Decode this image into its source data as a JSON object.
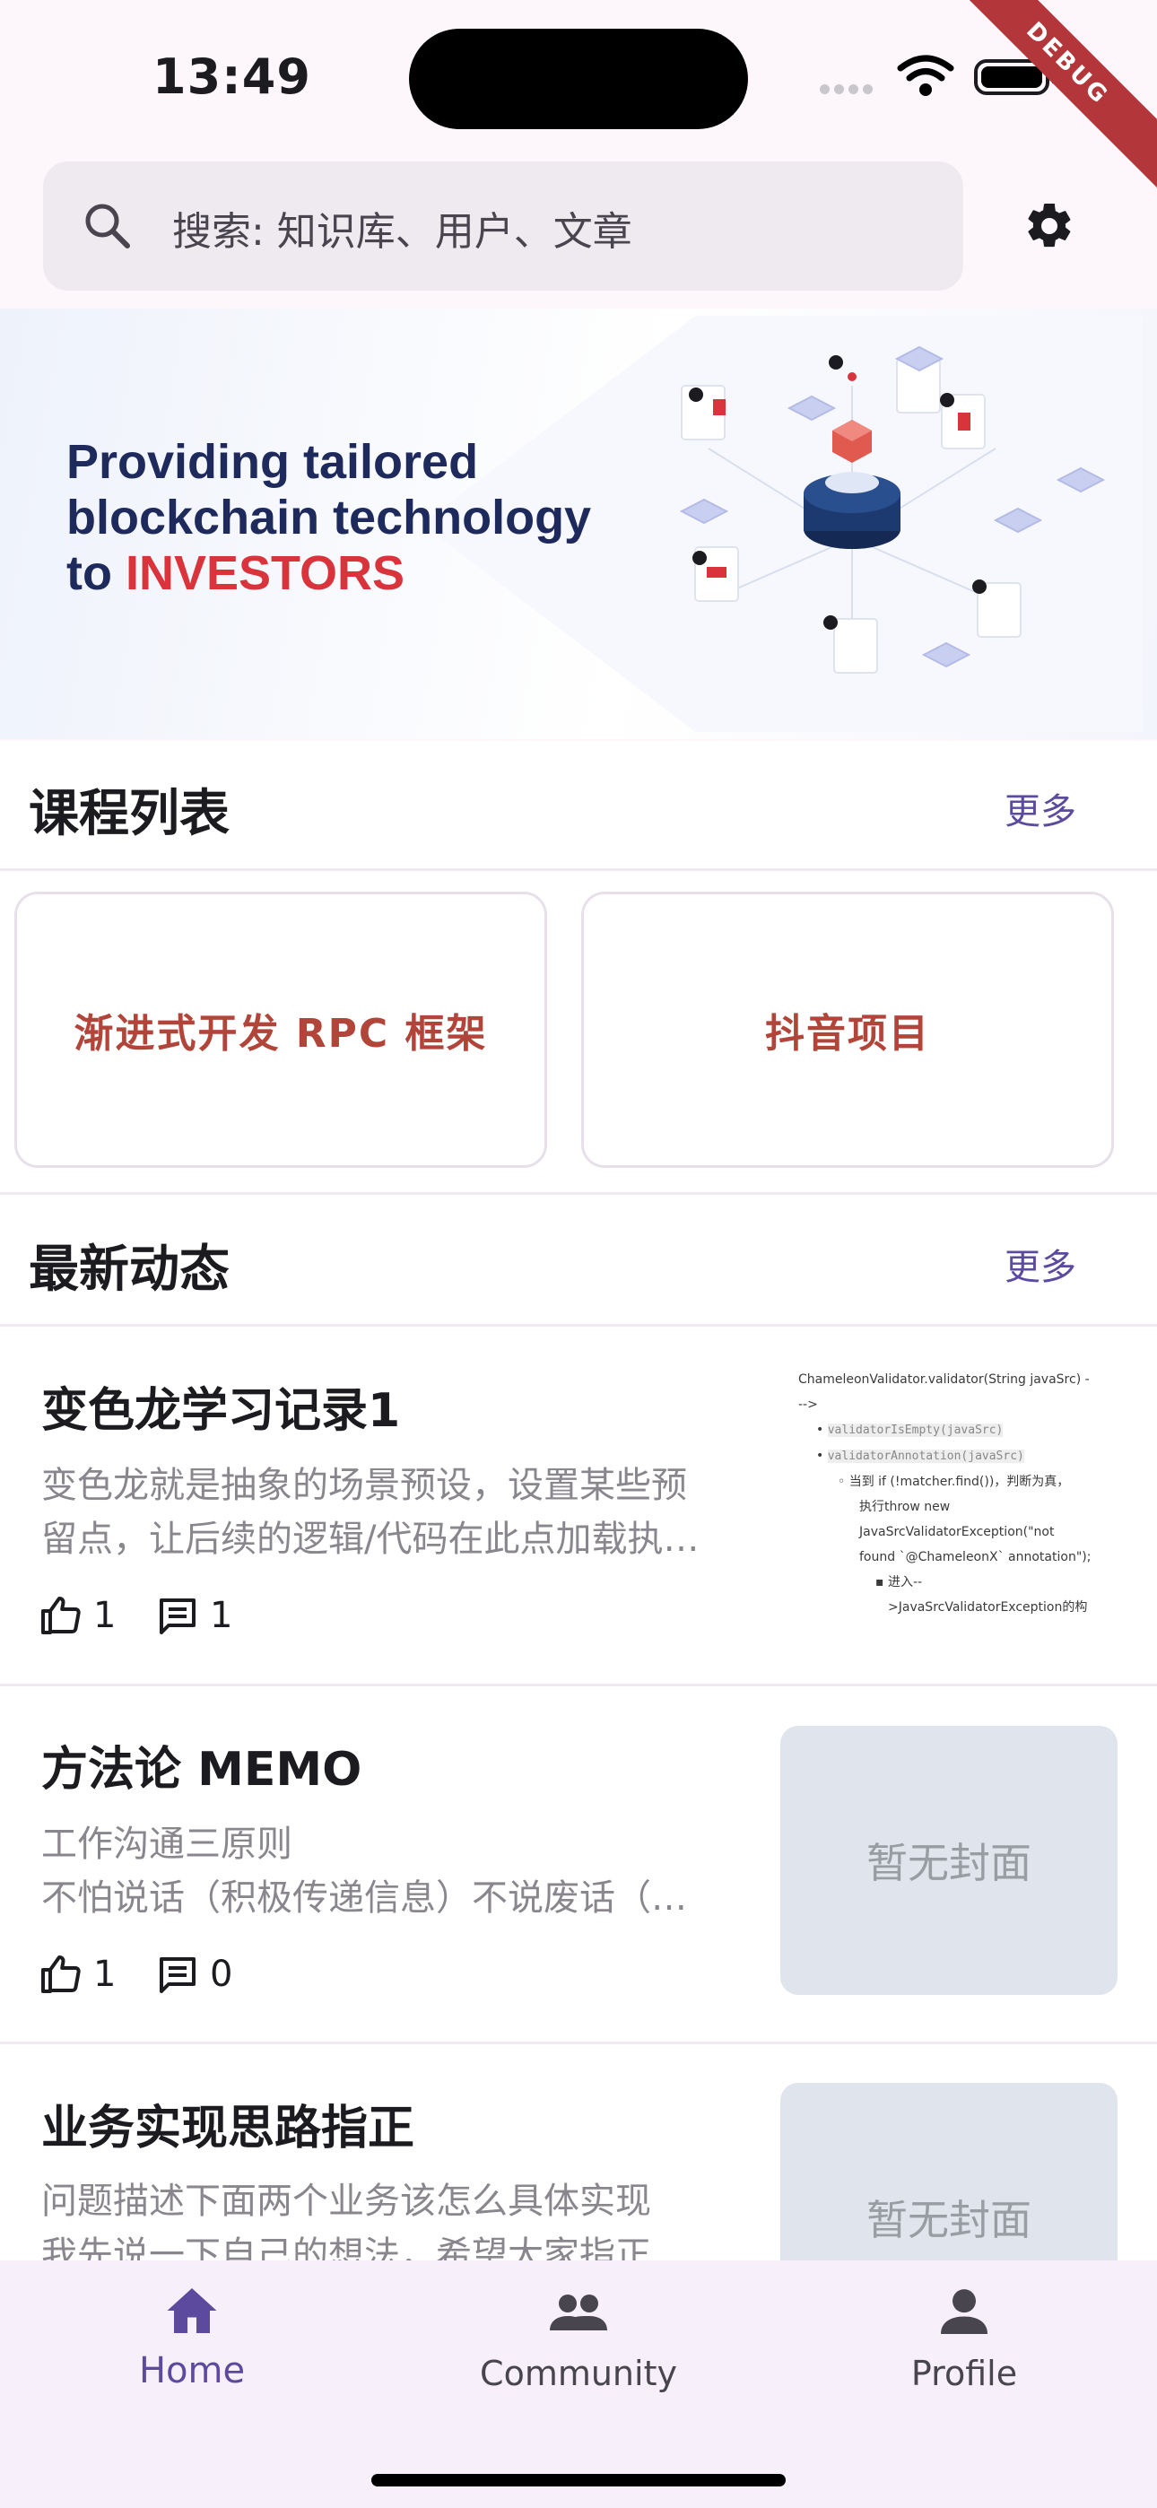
{
  "status": {
    "time": "13:49"
  },
  "debug_banner": "DEBUG",
  "search": {
    "placeholder": "搜索: 知识库、用户、文章"
  },
  "banner": {
    "line1": "Providing tailored",
    "line2": "blockchain technology",
    "line3_prefix": "to ",
    "line3_highlight": "INVESTORS",
    "highlight_color": "#d9343c"
  },
  "courses": {
    "title": "课程列表",
    "more": "更多",
    "items": [
      {
        "title": "渐进式开发 RPC 框架"
      },
      {
        "title": "抖音项目"
      }
    ]
  },
  "feed": {
    "title": "最新动态",
    "more": "更多",
    "posts": [
      {
        "title": "变色龙学习记录1",
        "line1": "变色龙就是抽象的场景预设，设置某些预",
        "line2": "留点，让后续的逻辑/代码在此点加载执…",
        "likes": "1",
        "comments": "1",
        "cover": {
          "l1": "ChameleonValidator.validator(String javaSrc) -",
          "l2": "-->",
          "code1": "validatorIsEmpty(javaSrc)",
          "code2": "validatorAnnotation(javaSrc)",
          "l3": "当到 if (!matcher.find())，判断为真，",
          "l4": "执行throw new",
          "l5": "JavaSrcValidatorException(\"not",
          "l6": "found `@ChameleonX` annotation\");",
          "l7": "进入--",
          "l8": ">JavaSrcValidatorException的构"
        }
      },
      {
        "title": "方法论 MEMO",
        "line1": "工作沟通三原则",
        "line2": "不怕说话（积极传递信息）不说废话（…",
        "likes": "1",
        "comments": "0",
        "cover_text": "暂无封面"
      },
      {
        "title": "业务实现思路指正",
        "line1": "问题描述下面两个业务该怎么具体实现",
        "line2": "我先说一下自己的想法，希望大家指正",
        "cover_text": "暂无封面"
      }
    ]
  },
  "nav": {
    "items": [
      {
        "label": "Home",
        "icon": "home-icon"
      },
      {
        "label": "Community",
        "icon": "people-icon"
      },
      {
        "label": "Profile",
        "icon": "person-icon"
      }
    ],
    "active_color": "#5b4a9e"
  }
}
